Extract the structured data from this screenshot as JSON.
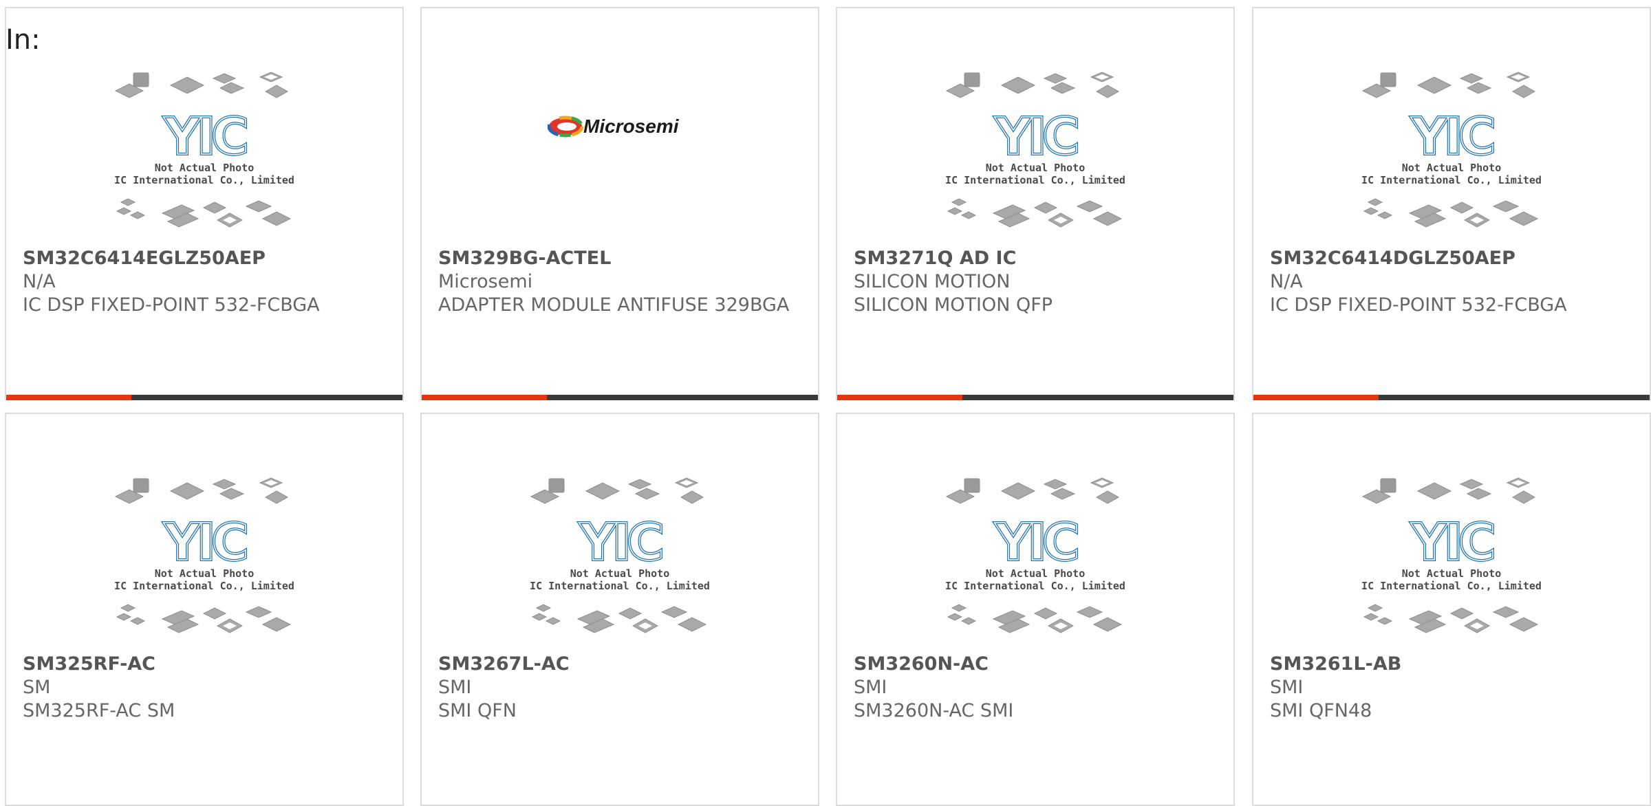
{
  "header": {
    "label": "In:"
  },
  "placeholder": {
    "line1": "Not Actual Photo",
    "line2": "YIC International Co., Limited.",
    "logo_text": "YIC"
  },
  "colors": {
    "accent": "#e8340f",
    "bar": "#3a3a3a",
    "logo_blue": "#1f74b8",
    "chip_gray": "#a9a9a9"
  },
  "products": [
    {
      "part": "SM32C6414EGLZ50AEP",
      "manufacturer": "N/A",
      "description": "IC DSP FIXED-POINT 532-FCBGA",
      "image": "placeholder"
    },
    {
      "part": "SM329BG-ACTEL",
      "manufacturer": "Microsemi",
      "description": "ADAPTER MODULE ANTIFUSE 329BGA",
      "image": "microsemi-logo",
      "logo_text": "Microsemi"
    },
    {
      "part": "SM3271Q AD IC",
      "manufacturer": "SILICON MOTION",
      "description": "SILICON MOTION QFP",
      "image": "placeholder"
    },
    {
      "part": "SM32C6414DGLZ50AEP",
      "manufacturer": "N/A",
      "description": "IC DSP FIXED-POINT 532-FCBGA",
      "image": "placeholder"
    },
    {
      "part": "SM325RF-AC",
      "manufacturer": "SM",
      "description": "SM325RF-AC SM",
      "image": "placeholder"
    },
    {
      "part": "SM3267L-AC",
      "manufacturer": "SMI",
      "description": "SMI QFN",
      "image": "placeholder"
    },
    {
      "part": "SM3260N-AC",
      "manufacturer": "SMI",
      "description": "SM3260N-AC SMI",
      "image": "placeholder"
    },
    {
      "part": "SM3261L-AB",
      "manufacturer": "SMI",
      "description": "SMI QFN48",
      "image": "placeholder"
    }
  ]
}
